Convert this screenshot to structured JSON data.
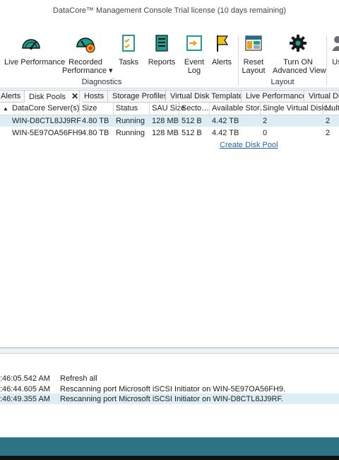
{
  "window": {
    "title": "DataCore™ Management Console   Trial license (10 days remaining)"
  },
  "ribbon": {
    "buttons": [
      {
        "label": "Live Performance",
        "label2": "",
        "icon": "dashboard-icon"
      },
      {
        "label": "Recorded",
        "label2": "Performance ▾",
        "icon": "recorded-performance-icon"
      },
      {
        "label": "Tasks",
        "label2": "",
        "icon": "tasks-icon"
      },
      {
        "label": "Reports",
        "label2": "",
        "icon": "reports-icon"
      },
      {
        "label": "Event",
        "label2": "Log",
        "icon": "event-log-icon"
      },
      {
        "label": "Alerts",
        "label2": "",
        "icon": "alerts-flag-icon"
      },
      {
        "label": "Reset",
        "label2": "Layout",
        "icon": "reset-layout-icon"
      },
      {
        "label": "Turn ON",
        "label2": "Advanced View",
        "icon": "gear-icon"
      },
      {
        "label": "Us",
        "label2": "",
        "icon": "users-icon"
      }
    ],
    "groups": {
      "diagnostics": "Diagnostics",
      "layout": "Layout"
    }
  },
  "tabs": [
    "Alerts",
    "Disk Pools",
    "Hosts",
    "Storage Profiles",
    "Virtual Disk Templates",
    "Live Performance",
    "Virtual Disk"
  ],
  "grid": {
    "columns": [
      "DataCore Server(s)",
      "Size",
      "Status",
      "SAU Size",
      "Secto…",
      "Available Stor…",
      "Single Virtual Disk…",
      "Multi"
    ],
    "rows": [
      [
        "WIN-D8CTL8JJ9RF",
        "4.80 TB",
        "Running",
        "128 MB",
        "512 B",
        "4.42 TB",
        "2",
        "2"
      ],
      [
        "WIN-5E97OA56FH9",
        "4.80 TB",
        "Running",
        "128 MB",
        "512 B",
        "4.42 TB",
        "0",
        "2"
      ]
    ],
    "create_link": "Create Disk Pool"
  },
  "log": [
    {
      "time": ":46:05.542 AM",
      "msg": "Refresh all"
    },
    {
      "time": ":46:44.605 AM",
      "msg": "Rescanning port Microsoft iSCSI Initiator on WIN-5E97OA56FH9."
    },
    {
      "time": ":46:49.355 AM",
      "msg": "Rescanning port Microsoft iSCSI Initiator on WIN-D8CTL8JJ9RF."
    }
  ],
  "colors": {
    "accent": "#2d7584",
    "selection": "#dcedf3",
    "link": "#2066b0"
  }
}
